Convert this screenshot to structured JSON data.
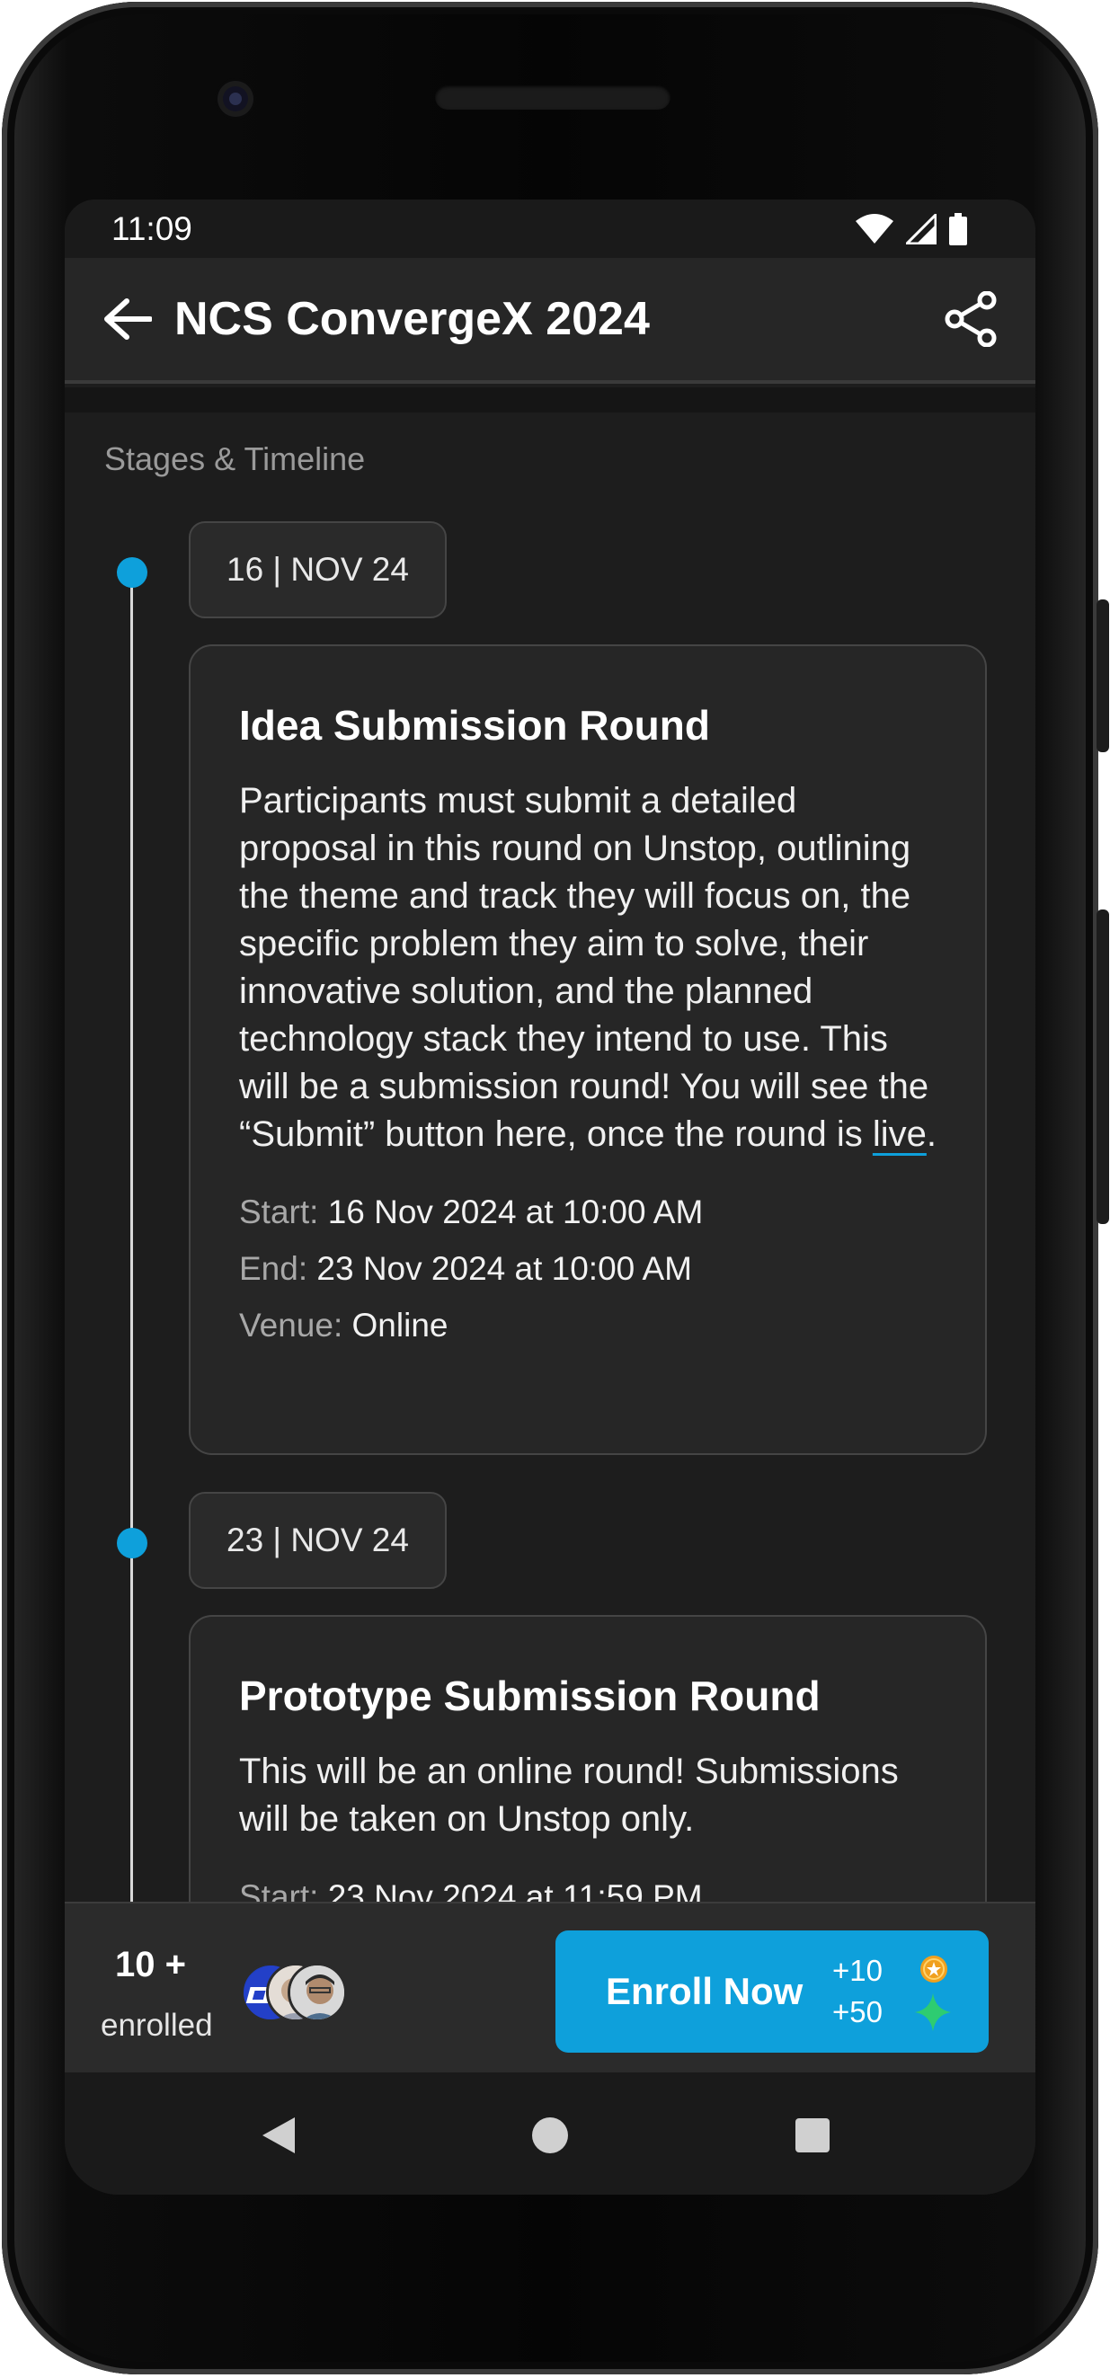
{
  "status_bar": {
    "time": "11:09"
  },
  "header": {
    "title": "NCS ConvergeX 2024"
  },
  "timeline": {
    "section_title": "Stages & Timeline",
    "stages": [
      {
        "date": "16  |  NOV 24",
        "title": "Idea Submission Round",
        "description_before_link": "Participants must submit a detailed proposal in this round on Unstop, outlining the theme and track they will focus on, the specific problem they aim to solve, their innovative solution, and the planned technology stack they intend to use.  This will be a submission round! You will see the “Submit” button here, once the round is ",
        "description_link": "live",
        "description_after_link": ".",
        "start_label": "Start:",
        "start_value": "16 Nov 2024 at 10:00 AM",
        "end_label": "End:",
        "end_value": "23 Nov 2024 at 10:00 AM",
        "venue_label": "Venue:",
        "venue_value": "Online"
      },
      {
        "date": "23  |  NOV 24",
        "title": "Prototype Submission Round",
        "description": "This will be an online round! Submissions will be taken on Unstop only.",
        "start_label": "Start:",
        "start_value": "23 Nov 2024 at 11:59 PM"
      }
    ]
  },
  "enroll_bar": {
    "count": "10 +",
    "label": "enrolled",
    "button_label": "Enroll Now",
    "reward_coins": "+10",
    "reward_xp": "+50",
    "colors": {
      "accent": "#0ea0db",
      "coin": "#f0a01e",
      "spark": "#2ecc71"
    }
  }
}
